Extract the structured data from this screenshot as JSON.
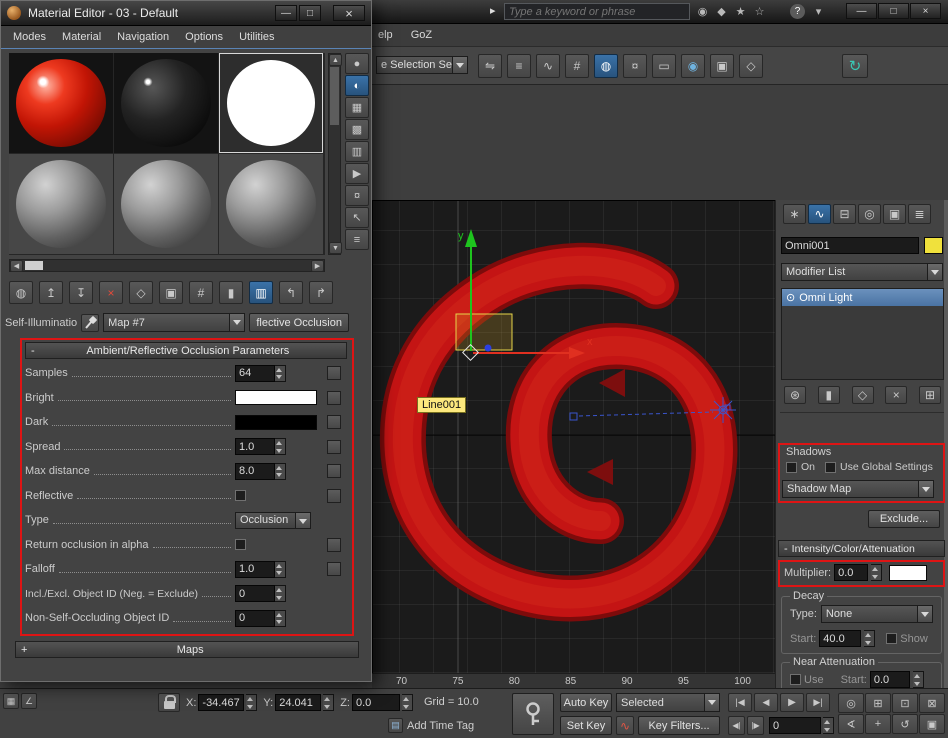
{
  "chrome": {
    "overflow_arrow": "▸",
    "search_placeholder": "Type a keyword or phrase",
    "search_icons": [
      {
        "name": "binoculars",
        "glyph": "◉"
      },
      {
        "name": "key",
        "glyph": "◆"
      },
      {
        "name": "star",
        "glyph": "★"
      },
      {
        "name": "favorites",
        "glyph": "☆"
      }
    ],
    "help_glyph": "?",
    "chevron_glyph": "▾",
    "btn_min": "—",
    "btn_max": "□",
    "btn_close": "×"
  },
  "menubar": {
    "help_fragment": "elp",
    "goz": "GoZ"
  },
  "main_toolbar": {
    "selection_set_value": "e Selection Se",
    "icons": [
      {
        "name": "mirror",
        "glyph": "⇋"
      },
      {
        "name": "align",
        "glyph": "≡"
      },
      {
        "name": "curve-editor",
        "glyph": "∿"
      },
      {
        "name": "schematic-view",
        "glyph": "#"
      },
      {
        "name": "material-editor",
        "glyph": "◍"
      },
      {
        "name": "render-setup",
        "glyph": "¤"
      },
      {
        "name": "rendered-frame",
        "glyph": "▭"
      },
      {
        "name": "render-production",
        "glyph": "◉"
      },
      {
        "name": "put-to-library",
        "glyph": "▣"
      },
      {
        "name": "state-sets",
        "glyph": "◇"
      }
    ],
    "goz_glyph": "↻"
  },
  "material_editor": {
    "title": "Material Editor - 03 - Default",
    "btn_min": "—",
    "btn_max": "□",
    "btn_close": "×",
    "menus": [
      "Modes",
      "Material",
      "Navigation",
      "Options",
      "Utilities"
    ],
    "side_tools": [
      {
        "name": "sample-type",
        "glyph": "●"
      },
      {
        "name": "backlight",
        "glyph": "◐"
      },
      {
        "name": "background",
        "glyph": "▦"
      },
      {
        "name": "sample-uv-tiling",
        "glyph": "▩"
      },
      {
        "name": "video-color-check",
        "glyph": "▥"
      },
      {
        "name": "make-preview",
        "glyph": "▶"
      },
      {
        "name": "options",
        "glyph": "¤"
      },
      {
        "name": "select-by-material",
        "glyph": "↖"
      },
      {
        "name": "material-map-navigator",
        "glyph": "≡"
      }
    ],
    "scroll": {
      "up": "▲",
      "down": "▼",
      "left": "◀",
      "right": "▶"
    },
    "toolbar": [
      {
        "name": "get-material",
        "glyph": "◍"
      },
      {
        "name": "put-material",
        "glyph": "↥"
      },
      {
        "name": "assign-to-selection",
        "glyph": "↧"
      },
      {
        "name": "reset-map",
        "glyph": "×"
      },
      {
        "name": "make-unique",
        "glyph": "◇"
      },
      {
        "name": "put-to-library",
        "glyph": "▣"
      },
      {
        "name": "material-id-channel",
        "glyph": "#"
      },
      {
        "name": "show-end-result",
        "glyph": "▮"
      },
      {
        "name": "show-in-viewport",
        "glyph": "▥"
      },
      {
        "name": "go-to-parent",
        "glyph": "↰"
      },
      {
        "name": "go-forward-sibling",
        "glyph": "↱"
      }
    ],
    "self_illum_label": "Self-Illuminatio",
    "map_name": "Map #7",
    "parent_type_button": "flective Occlusion",
    "rollout": {
      "collapse_glyph": "-",
      "title": "Ambient/Reflective Occlusion Parameters",
      "params": [
        {
          "label": "Samples",
          "value": "64"
        },
        {
          "label": "Bright",
          "color": "#ffffff"
        },
        {
          "label": "Dark",
          "color": "#000000"
        },
        {
          "label": "Spread",
          "value": "1.0"
        },
        {
          "label": "Max distance",
          "value": "8.0"
        },
        {
          "label": "Reflective"
        },
        {
          "label": "Type",
          "value": "Occlusion"
        },
        {
          "label": "Return occlusion in alpha"
        },
        {
          "label": "Falloff",
          "value": "1.0"
        },
        {
          "label": "Incl./Excl. Object ID (Neg. = Exclude)",
          "value": "0"
        },
        {
          "label": "Non-Self-Occluding Object ID",
          "value": "0"
        }
      ]
    },
    "maps_rollout": {
      "expand_glyph": "+",
      "title": "Maps"
    }
  },
  "viewport": {
    "object_label": "Line001",
    "axis_x": "x",
    "axis_y": "y",
    "ticks": [
      "70",
      "75",
      "80",
      "85",
      "90",
      "95",
      "100"
    ]
  },
  "panel": {
    "tabs": [
      {
        "name": "create",
        "glyph": "∗"
      },
      {
        "name": "modify",
        "glyph": "∿"
      },
      {
        "name": "hierarchy",
        "glyph": "⊟"
      },
      {
        "name": "motion",
        "glyph": "◎"
      },
      {
        "name": "display",
        "glyph": "▣"
      },
      {
        "name": "utilities",
        "glyph": "≣"
      }
    ],
    "object_name": "Omni001",
    "wire_color": "#f0e13c",
    "modifier_list_label": "Modifier List",
    "stack_item": "Omni Light",
    "stack_item_glyph": "⊙",
    "stack_tools": [
      {
        "name": "pin-stack",
        "glyph": "⊛"
      },
      {
        "name": "show-end-result",
        "glyph": "▮"
      },
      {
        "name": "make-unique",
        "glyph": "◇"
      },
      {
        "name": "remove-modifier",
        "glyph": "×"
      },
      {
        "name": "configure-modifier-sets",
        "glyph": "⊞"
      }
    ],
    "shadows": {
      "label": "Shadows",
      "on_label": "On",
      "global_label": "Use Global Settings",
      "type_value": "Shadow Map"
    },
    "exclude_button": "Exclude...",
    "rollout_collapse": "-",
    "rollout_title": "Intensity/Color/Attenuation",
    "multiplier_label": "Multiplier:",
    "multiplier_value": "0.0",
    "multiplier_color": "#ffffff",
    "decay": {
      "label": "Decay",
      "type_label": "Type:",
      "type_value": "None",
      "start_label": "Start:",
      "start_value": "40.0",
      "show_label": "Show"
    },
    "near_attenuation": {
      "label": "Near Attenuation",
      "use_label": "Use",
      "start_label": "Start:",
      "start_value": "0.0"
    }
  },
  "statusbar": {
    "left_icons": [
      {
        "name": "status-grid",
        "glyph": "▦"
      },
      {
        "name": "status-angle",
        "glyph": "∠"
      }
    ],
    "x_label": "X:",
    "x_value": "-34.467",
    "y_label": "Y:",
    "y_value": "24.041",
    "z_label": "Z:",
    "z_value": "0.0",
    "grid_text": "Grid = 10.0",
    "time_tag_glyph": "▤",
    "time_tag_label": "Add Time Tag",
    "auto_key_label": "Auto Key",
    "set_key_label": "Set Key",
    "key_mode_value": "Selected",
    "key_filters_label": "Key Filters...",
    "tangent_glyph": "∿",
    "frame_value": "0",
    "playback": [
      {
        "name": "go-to-start",
        "glyph": "|◀"
      },
      {
        "name": "previous-frame",
        "glyph": "◀"
      },
      {
        "name": "play",
        "glyph": "▶"
      },
      {
        "name": "go-to-end",
        "glyph": "▶|"
      }
    ],
    "key_steps": [
      {
        "name": "previous-key",
        "glyph": "◀|"
      },
      {
        "name": "next-key",
        "glyph": "|▶"
      }
    ],
    "nav_icons": [
      {
        "name": "zoom",
        "glyph": "◎"
      },
      {
        "name": "zoom-all",
        "glyph": "⊞"
      },
      {
        "name": "zoom-extents",
        "glyph": "⊡"
      },
      {
        "name": "zoom-extents-all",
        "glyph": "⊠"
      },
      {
        "name": "field-of-view",
        "glyph": "∢"
      },
      {
        "name": "pan",
        "glyph": "+"
      },
      {
        "name": "orbit",
        "glyph": "↺"
      },
      {
        "name": "maximize-viewport",
        "glyph": "▣"
      }
    ]
  }
}
